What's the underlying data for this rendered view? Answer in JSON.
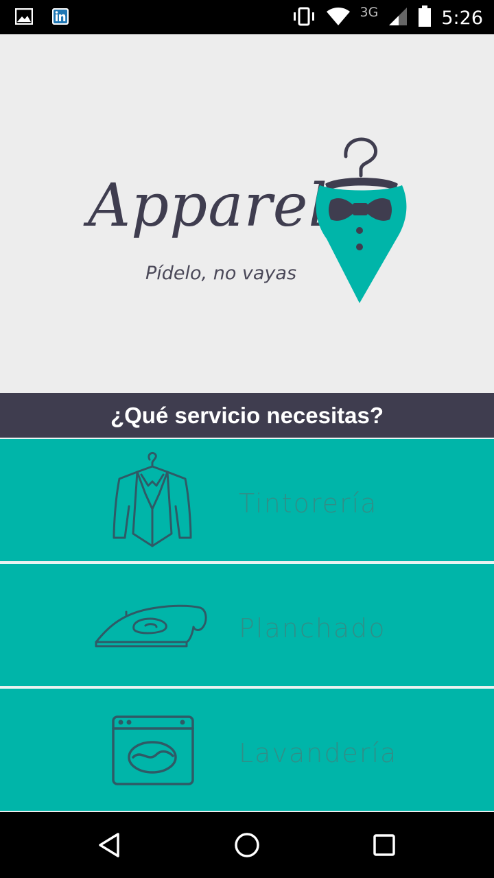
{
  "status_bar": {
    "time": "5:26",
    "network": "3G",
    "icons": [
      "image-icon",
      "linkedin-icon",
      "vibrate-icon",
      "wifi-icon",
      "signal-icon",
      "battery-icon"
    ]
  },
  "brand": {
    "name": "Apparel",
    "tagline": "Pídelo, no vayas",
    "accent_color": "#00b5a9",
    "dark_color": "#3f3d4f"
  },
  "header": {
    "title": "¿Qué servicio necesitas?"
  },
  "services": [
    {
      "label": "Tintorería",
      "icon": "suit-icon"
    },
    {
      "label": "Planchado",
      "icon": "iron-icon"
    },
    {
      "label": "Lavandería",
      "icon": "washing-machine-icon"
    }
  ],
  "nav": {
    "icons": [
      "back-icon",
      "home-icon",
      "recents-icon"
    ]
  }
}
